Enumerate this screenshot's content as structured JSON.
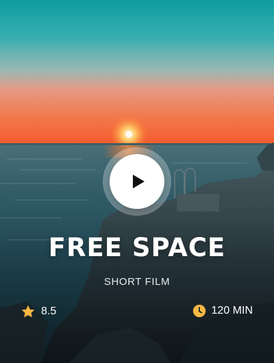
{
  "card": {
    "title": "FREE SPACE",
    "subtitle": "SHORT FILM",
    "rating": "8.5",
    "duration": "120 MIN"
  },
  "icons": {
    "play": "play-icon",
    "rating": "star-icon",
    "duration": "clock-icon"
  },
  "colors": {
    "accent": "#f7b844",
    "title_text": "#ffffff",
    "play_button": "#ffffff"
  }
}
